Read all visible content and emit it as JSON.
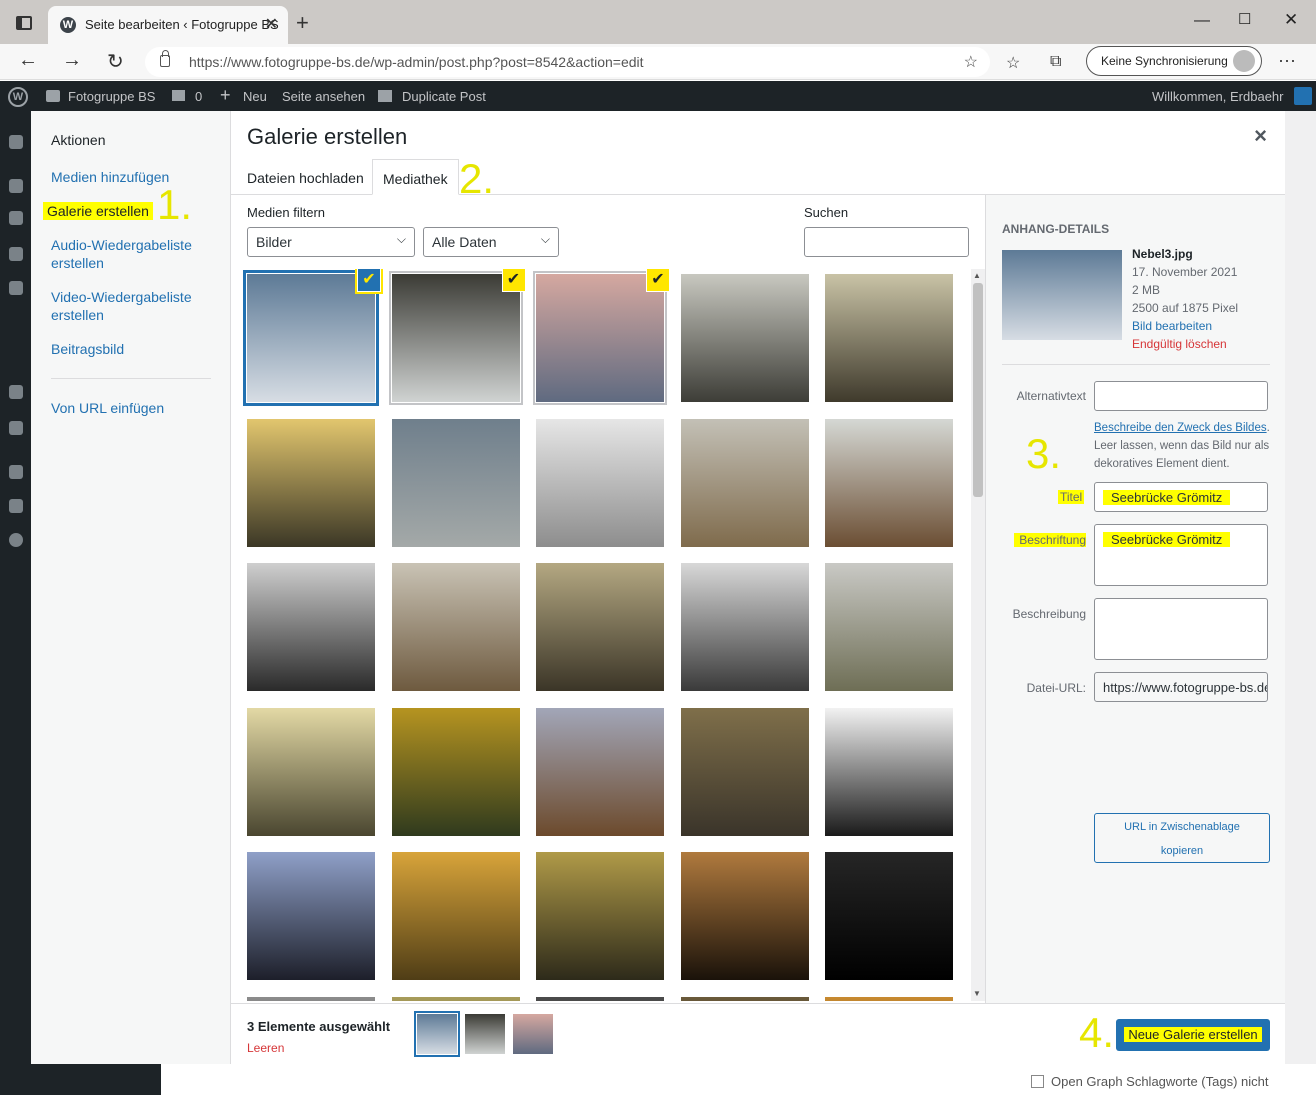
{
  "browser": {
    "tab_title": "Seite bearbeiten ‹ Fotogruppe BS",
    "tab_close": "✕",
    "new_tab": "+",
    "url": "https://www.fotogruppe-bs.de/wp-admin/post.php?post=8542&action=edit",
    "sync_label": "Keine Synchronisierung",
    "more": "···"
  },
  "adminbar": {
    "site_name": "Fotogruppe BS",
    "comments_count": "0",
    "new_label": "Neu",
    "view_page": "Seite ansehen",
    "duplicate_post": "Duplicate Post",
    "welcome": "Willkommen, Erdbaehr"
  },
  "background": {
    "checkbox_label": "Open Graph Schlagworte (Tags) nicht"
  },
  "menu": {
    "heading": "Aktionen",
    "items": [
      "Medien hinzufügen",
      "Galerie erstellen",
      "Audio-Wiedergabeliste erstellen",
      "Video-Wiedergabeliste erstellen",
      "Beitragsbild",
      "Von URL einfügen"
    ]
  },
  "annotations": [
    "1.",
    "2.",
    "3.",
    "4."
  ],
  "frame": {
    "title": "Galerie erstellen",
    "close": "×",
    "tabs": [
      "Dateien hochladen",
      "Mediathek"
    ],
    "filter_label": "Medien filtern",
    "filter_type": "Bilder",
    "filter_date": "Alle Daten",
    "search_label": "Suchen"
  },
  "grid": {
    "items": [
      {
        "name": "foggy pier",
        "c1": "#5d7a96",
        "c2": "#d7dde4",
        "selected": true,
        "current": true
      },
      {
        "name": "bridge over river",
        "c1": "#3b3b35",
        "c2": "#d0d3d2",
        "selected": true
      },
      {
        "name": "pastel beach sunset",
        "c1": "#d5a8a0",
        "c2": "#5f6a80",
        "selected": true
      },
      {
        "name": "wooden hut on stilts",
        "c1": "#c8c8c0",
        "c2": "#3d3d37"
      },
      {
        "name": "pavilion in mist",
        "c1": "#c9c3a6",
        "c2": "#3f3a2c"
      },
      {
        "name": "sunrise behind tree",
        "c1": "#e2c66e",
        "c2": "#3b3726"
      },
      {
        "name": "sea with fog bank",
        "c1": "#6f7f8c",
        "c2": "#a4a9a8"
      },
      {
        "name": "snowy fir trees",
        "c1": "#e6e6e6",
        "c2": "#8d8d8d"
      },
      {
        "name": "trees in foggy field",
        "c1": "#c3c0b6",
        "c2": "#7f6b4c"
      },
      {
        "name": "stacked logs",
        "c1": "#d5d8d4",
        "c2": "#6b4e33"
      },
      {
        "name": "dark foggy forest",
        "c1": "#cfcfcf",
        "c2": "#2a2a2a"
      },
      {
        "name": "misty pine forest",
        "c1": "#c9c3b5",
        "c2": "#6e5a3f"
      },
      {
        "name": "golden mist landscape",
        "c1": "#b4a882",
        "c2": "#3b3527"
      },
      {
        "name": "bare trees in fog",
        "c1": "#d8d8d8",
        "c2": "#3a3a3a"
      },
      {
        "name": "path through hills",
        "c1": "#c9c9c5",
        "c2": "#6e6e55"
      },
      {
        "name": "backlit tree at dawn",
        "c1": "#e3d9a5",
        "c2": "#4a4630"
      },
      {
        "name": "autumn leaves",
        "c1": "#b69420",
        "c2": "#2f3a1e"
      },
      {
        "name": "heath in autumn",
        "c1": "#a2a6b8",
        "c2": "#6c4a2c"
      },
      {
        "name": "dog on rail track",
        "c1": "#7f6f4a",
        "c2": "#3a342a"
      },
      {
        "name": "tree canopy from below",
        "c1": "#f2f2f2",
        "c2": "#1a1a1a"
      },
      {
        "name": "leaf at sunset",
        "c1": "#8fa0c8",
        "c2": "#1d1f2a"
      },
      {
        "name": "yellow maple leaves",
        "c1": "#d8a43a",
        "c2": "#4f3d16"
      },
      {
        "name": "trees reflected in water",
        "c1": "#b09a48",
        "c2": "#2d2a1a"
      },
      {
        "name": "chestnut in shell",
        "c1": "#b07a3e",
        "c2": "#1a120a"
      },
      {
        "name": "dark twig with leaf",
        "c1": "#262626",
        "c2": "#000000"
      },
      {
        "name": "row 6 a",
        "c1": "#8c8c8c",
        "c2": "#2a2a2a"
      },
      {
        "name": "row 6 b",
        "c1": "#a89c5a",
        "c2": "#2f2a18"
      },
      {
        "name": "row 6 c",
        "c1": "#4b4b4b",
        "c2": "#1d1d1d"
      },
      {
        "name": "row 6 d",
        "c1": "#6a5a3a",
        "c2": "#1d1a12"
      },
      {
        "name": "row 6 e",
        "c1": "#c88a30",
        "c2": "#1a120a"
      }
    ]
  },
  "details": {
    "heading": "Anhang-Details",
    "filename": "Nebel3.jpg",
    "date": "17. November 2021",
    "size": "2 MB",
    "dimensions": "2500 auf 1875 Pixel",
    "edit_link": "Bild bearbeiten",
    "delete_link": "Endgültig löschen",
    "alt_label": "Alternativtext",
    "alt_help_link": "Beschreibe den Zweck des Bildes",
    "alt_help_rest": ". Leer lassen, wenn das Bild nur als dekoratives Element dient.",
    "title_label": "Titel",
    "title_value": "Seebrücke Grömitz",
    "caption_label": "Beschriftung",
    "caption_value": "Seebrücke Grömitz",
    "description_label": "Beschreibung",
    "file_url_label": "Datei-URL:",
    "file_url_value": "https://www.fotogruppe-bs.de",
    "copy_label_1": "URL in Zwischenablage",
    "copy_label_2": "kopieren"
  },
  "selection": {
    "count_label": "3 Elemente ausgewählt",
    "clear_label": "Leeren",
    "button_label": "Neue Galerie erstellen"
  },
  "colors": {
    "accent": "#2271b1",
    "highlight": "#ffff00",
    "annotation": "#e6e600",
    "delete": "#d63638"
  }
}
